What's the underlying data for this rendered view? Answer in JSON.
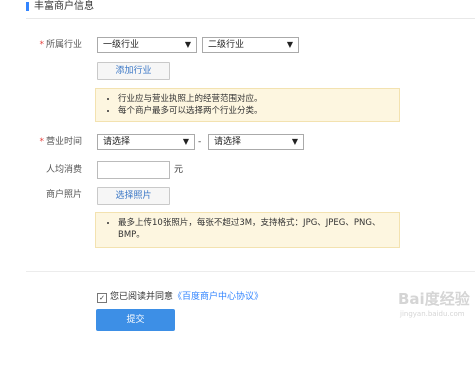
{
  "section": {
    "title": "丰富商户信息"
  },
  "industry": {
    "label": "所属行业",
    "required_mark": "*",
    "level1_selected": "一级行业",
    "level2_selected": "二级行业",
    "add_button": "添加行业",
    "notes": [
      "行业应与营业执照上的经营范围对应。",
      "每个商户最多可以选择两个行业分类。"
    ]
  },
  "hours": {
    "label": "营业时间",
    "required_mark": "*",
    "start_selected": "请选择",
    "separator": "-",
    "end_selected": "请选择"
  },
  "avg_spend": {
    "label": "人均消费",
    "value": "",
    "unit": "元"
  },
  "photos": {
    "label": "商户照片",
    "button": "选择照片",
    "note": "最多上传10张照片，每张不超过3M，支持格式：JPG、JPEG、PNG、BMP。"
  },
  "agreement": {
    "checked": true,
    "checkmark": "✓",
    "prefix": "您已阅读并同意",
    "link": "《百度商户中心协议》"
  },
  "submit_label": "提交",
  "watermark": {
    "text": "Bai度经验",
    "subtext": "jingyan.baidu.com"
  },
  "colors": {
    "accent": "#3385ff",
    "submit": "#3d8fe6",
    "required": "#e64340",
    "note_bg": "#fdf6e0"
  }
}
